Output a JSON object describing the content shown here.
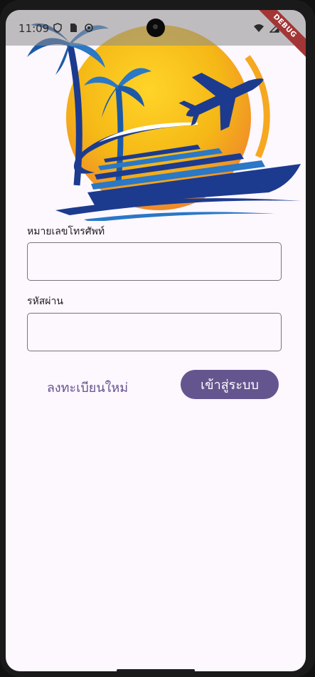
{
  "status_bar": {
    "time": "11:09",
    "left_icons": [
      "shield-icon",
      "sim-card-icon",
      "sync-icon"
    ],
    "right_icons": [
      "wifi-icon",
      "signal-icon",
      "battery-icon"
    ]
  },
  "debug_banner": "DEBUG",
  "logo": {
    "icon": "travel-logo",
    "colors": {
      "sun": "#f5b816",
      "navy": "#1c3b8f",
      "blue": "#2a78c6"
    }
  },
  "form": {
    "phone_label": "หมายเลขโทรศัพท์",
    "phone_value": "",
    "password_label": "รหัสผ่าน",
    "password_value": ""
  },
  "actions": {
    "register_label": "ลงทะเบียนใหม่",
    "login_label": "เข้าสู่ระบบ"
  },
  "theme": {
    "primary": "#65558f",
    "background": "#fdf7fe"
  }
}
